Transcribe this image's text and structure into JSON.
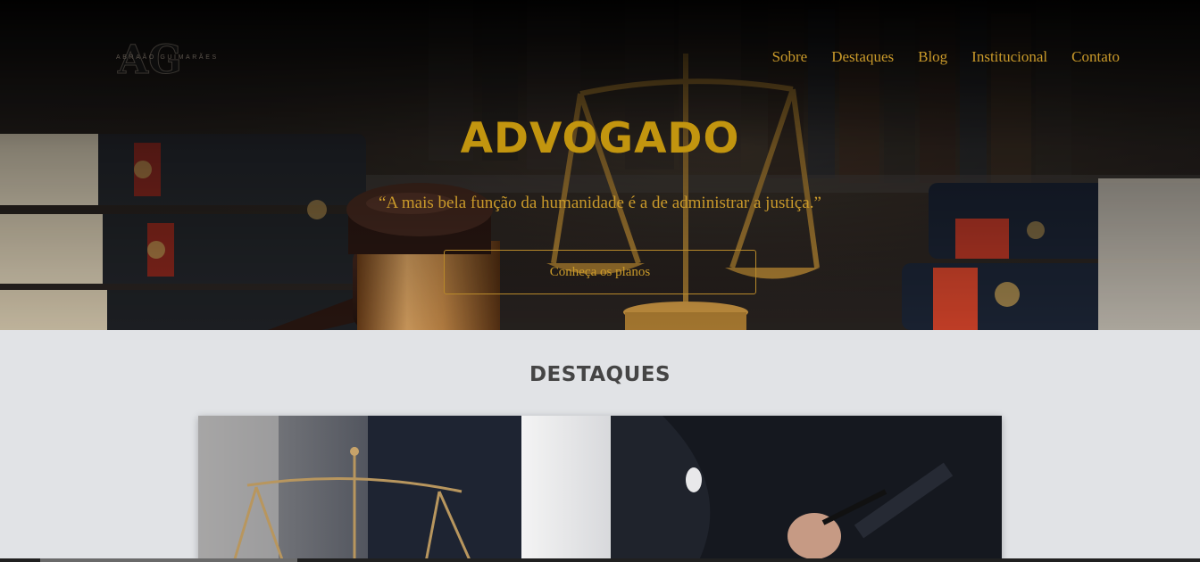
{
  "brand": {
    "logo_monogram": "AG",
    "logo_text": "ABRAÃO GUIMARÃES"
  },
  "nav": {
    "items": [
      {
        "label": "Sobre"
      },
      {
        "label": "Destaques"
      },
      {
        "label": "Blog"
      },
      {
        "label": "Institucional"
      },
      {
        "label": "Contato"
      }
    ]
  },
  "hero": {
    "title": "ADVOGADO",
    "quote": "“A mais bela função da humanidade é a de administrar a justiça.”",
    "cta_label": "Conheça os planos"
  },
  "highlights": {
    "title": "DESTAQUES"
  },
  "colors": {
    "accent_gold": "#c2950f",
    "nav_gold": "#c9992a",
    "section_bg": "#e1e3e6",
    "heading_dark": "#454545"
  }
}
